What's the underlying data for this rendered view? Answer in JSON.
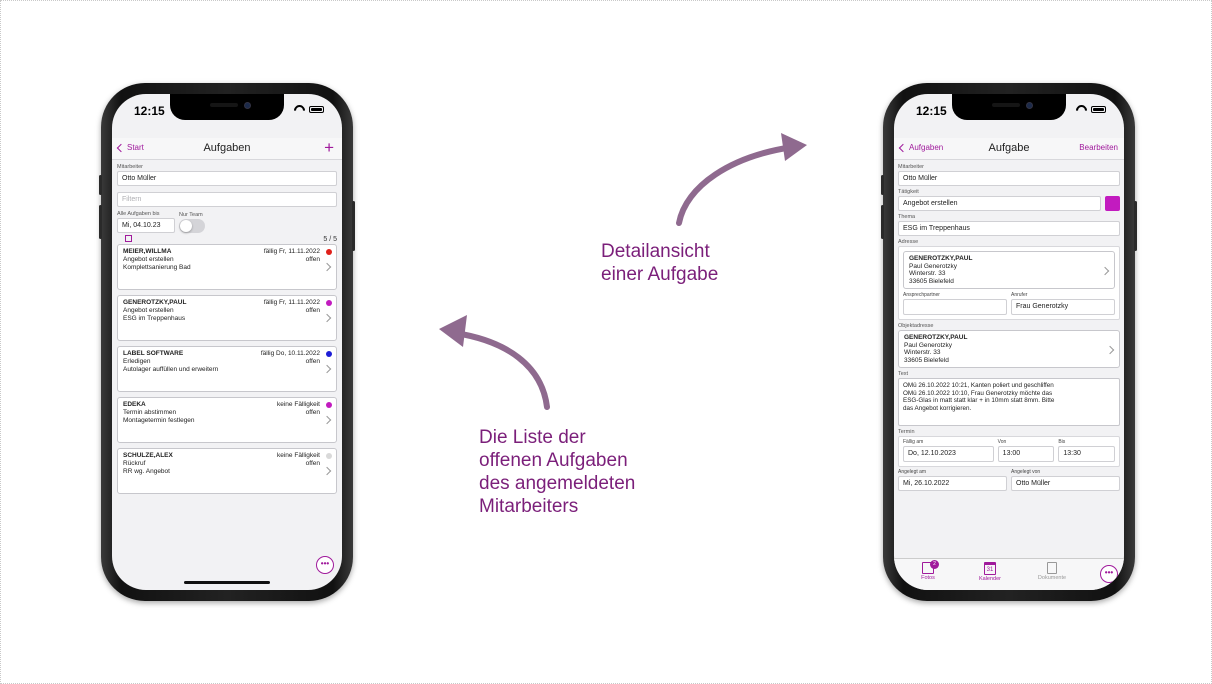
{
  "captions": {
    "detail": [
      "Detailansicht",
      "einer Aufgabe"
    ],
    "list": [
      "Die Liste der",
      "offenen Aufgaben",
      "des angemeldeten",
      "Mitarbeiters"
    ]
  },
  "colors": {
    "accent": "#a01a9c",
    "caption": "#7b1f7a",
    "arrow": "#8f6a8f"
  },
  "list_phone": {
    "status_time": "12:15",
    "nav": {
      "back": "Start",
      "title": "Aufgaben",
      "add_icon": "plus-icon"
    },
    "mitarbeiter_label": "Mitarbeiter",
    "mitarbeiter_value": "Otto Müller",
    "filter_placeholder": "Filtern",
    "alle_label": "Alle Aufgaben bis",
    "nur_team_label": "Nur Team",
    "date_value": "Mi, 04.10.23",
    "count": "5 / 5",
    "tasks": [
      {
        "name": "MEIER,WILLMA",
        "due": "fällig Fr, 11.11.2022",
        "activity": "Angebot erstellen",
        "status": "offen",
        "topic": "Komplettsanierung Bad",
        "color": "#e0201a"
      },
      {
        "name": "GENEROTZKY,PAUL",
        "due": "fällig Fr, 11.11.2022",
        "activity": "Angebot erstellen",
        "status": "offen",
        "topic": "ESG im Treppenhaus",
        "color": "#c21bbf"
      },
      {
        "name": "LABEL SOFTWARE",
        "due": "fällig Do, 10.11.2022",
        "activity": "Erledigen",
        "status": "offen",
        "topic": "Autolager auffüllen und erweitern",
        "color": "#1d1dd6"
      },
      {
        "name": "EDEKA",
        "due": "keine Fälligkeit",
        "activity": "Termin abstimmen",
        "status": "offen",
        "topic": "Montagetermin festlegen",
        "color": "#c21bbf"
      },
      {
        "name": "SCHULZE,ALEX",
        "due": "keine Fälligkeit",
        "activity": "Rückruf",
        "status": "offen",
        "topic": "RR wg. Angebot",
        "color": "#d9d9d9"
      }
    ],
    "more_label": "•••"
  },
  "detail_phone": {
    "status_time": "12:15",
    "nav": {
      "back": "Aufgaben",
      "title": "Aufgabe",
      "edit": "Bearbeiten"
    },
    "mitarbeiter_label": "Mitarbeiter",
    "mitarbeiter_value": "Otto Müller",
    "taetigkeit_label": "Tätigkeit",
    "taetigkeit_value": "Angebot erstellen",
    "taetigkeit_color": "#c21bbf",
    "thema_label": "Thema",
    "thema_value": "ESG im Treppenhaus",
    "adresse_label": "Adresse",
    "adresse": {
      "name": "GENEROTZKY,PAUL",
      "line1": "Paul Generotzky",
      "line2": "Winterstr. 33",
      "line3": "33605 Bielefeld"
    },
    "ansprechpartner_label": "Ansprechpartner",
    "ansprechpartner_value": "",
    "anrufer_label": "Anrufer",
    "anrufer_value": "Frau Generotzky",
    "objektadresse_label": "Objektadresse",
    "objektadresse": {
      "name": "GENEROTZKY,PAUL",
      "line1": "Paul Generotzky",
      "line2": "Winterstr. 33",
      "line3": "33605 Bielefeld"
    },
    "text_label": "Text",
    "text_lines": [
      "OMü 26.10.2022 10:21, Kanten poliert und geschliffen",
      "OMü 26.10.2022 10:10, Frau Generotzky möchte das",
      "ESG-Glas in matt statt klar + in 10mm statt 8mm. Bitte",
      "das Angebot korrigieren."
    ],
    "termin_label": "Termin",
    "faellig_label": "Fällig am",
    "faellig_value": "Do, 12.10.2023",
    "von_label": "Von",
    "von_value": "13:00",
    "bis_label": "Bis",
    "bis_value": "13:30",
    "angelegt_am_label": "Angelegt am",
    "angelegt_am_value": "Mi, 26.10.2022",
    "angelegt_von_label": "Angelegt von",
    "angelegt_von_value": "Otto Müller",
    "tabs": [
      {
        "label": "Fotos",
        "icon": "photos-icon",
        "badge": "2"
      },
      {
        "label": "Kalender",
        "icon": "calendar-icon",
        "day": "31"
      },
      {
        "label": "Dokumente",
        "icon": "document-icon"
      }
    ],
    "more_label": "•••"
  }
}
